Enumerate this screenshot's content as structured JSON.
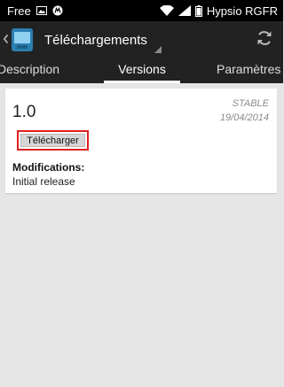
{
  "status_bar": {
    "carrier": "Free",
    "operator": "Hypsio RGFR"
  },
  "action_bar": {
    "title": "Téléchargements"
  },
  "tabs": [
    {
      "label": "Description"
    },
    {
      "label": "Versions"
    },
    {
      "label": "Paramètres"
    }
  ],
  "version_card": {
    "version": "1.0",
    "channel": "STABLE",
    "date": "19/04/2014",
    "download_label": "Télécharger",
    "modifications_title": "Modifications:",
    "modifications_text": "Initial release"
  }
}
